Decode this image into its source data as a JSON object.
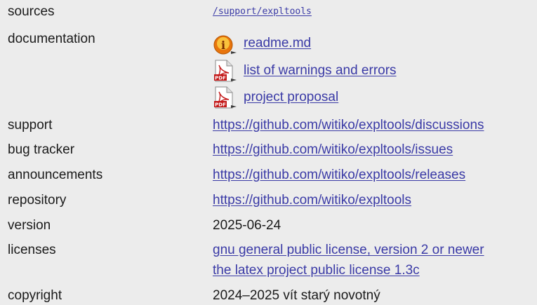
{
  "rows": {
    "sources": {
      "label": "sources",
      "value": "/support/expltools"
    },
    "documentation": {
      "label": "documentation",
      "items": [
        {
          "label": "readme.md",
          "icon": "info-icon"
        },
        {
          "label": "list of warnings and errors",
          "icon": "pdf-icon"
        },
        {
          "label": "project proposal",
          "icon": "pdf-icon"
        }
      ]
    },
    "support": {
      "label": "support",
      "value": "https://github.com/witiko/expltools/discussions"
    },
    "bug_tracker": {
      "label": "bug tracker",
      "value": "https://github.com/witiko/expltools/issues"
    },
    "announcements": {
      "label": "announcements",
      "value": "https://github.com/witiko/expltools/releases"
    },
    "repository": {
      "label": "repository",
      "value": "https://github.com/witiko/expltools"
    },
    "version": {
      "label": "version",
      "value": "2025-06-24"
    },
    "licenses": {
      "label": "licenses",
      "values": [
        "gnu general public license, version 2 or newer",
        "the latex project public license 1.3c"
      ]
    },
    "copyright": {
      "label": "copyright",
      "value": "2024–2025 vít starý novotný"
    }
  },
  "colors": {
    "background": "#ececec",
    "link": "#3a3aa6",
    "text": "#1a1a1a"
  }
}
